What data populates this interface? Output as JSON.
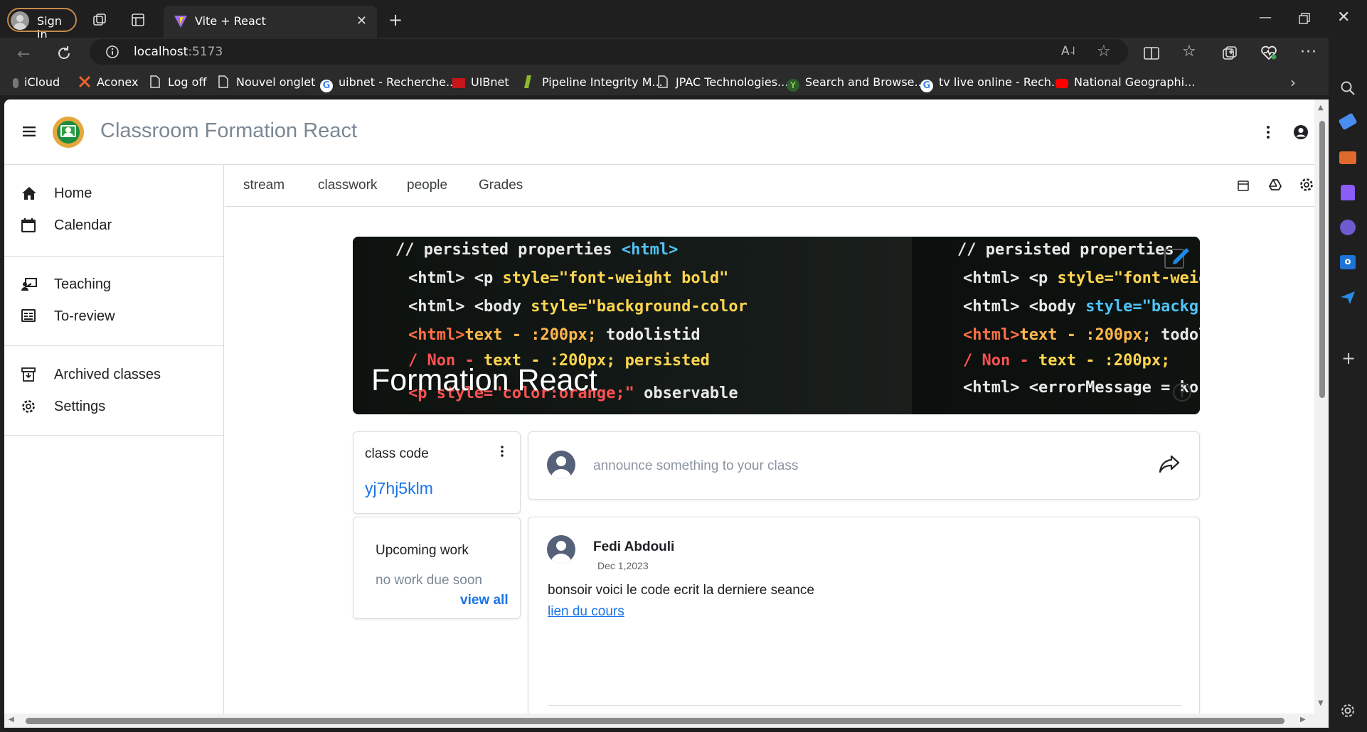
{
  "browser": {
    "signin_label": "Sign in",
    "tab_title": "Vite + React",
    "url_host": "localhost",
    "url_port": ":5173",
    "bookmarks": [
      {
        "label": "iCloud",
        "icon": "apple-icon"
      },
      {
        "label": "Aconex",
        "icon": "aconex-icon"
      },
      {
        "label": "Log off",
        "icon": "page-icon"
      },
      {
        "label": "Nouvel onglet",
        "icon": "page-icon"
      },
      {
        "label": "uibnet - Recherche...",
        "icon": "google-icon"
      },
      {
        "label": "UIBnet",
        "icon": "uibnet-icon"
      },
      {
        "label": "Pipeline Integrity M...",
        "icon": "pipeline-icon"
      },
      {
        "label": "JPAC Technologies...",
        "icon": "page-icon"
      },
      {
        "label": "Search and Browse...",
        "icon": "search-browse-icon"
      },
      {
        "label": "tv live online - Rech...",
        "icon": "google-icon"
      },
      {
        "label": "National Geographi...",
        "icon": "youtube-icon"
      }
    ]
  },
  "app": {
    "title": "Classroom Formation React"
  },
  "sidebar": {
    "items": [
      {
        "label": "Home",
        "icon": "home-icon"
      },
      {
        "label": "Calendar",
        "icon": "calendar-icon"
      },
      {
        "label": "Teaching",
        "icon": "teaching-icon"
      },
      {
        "label": "To-review",
        "icon": "to-review-icon"
      },
      {
        "label": "Archived classes",
        "icon": "archive-icon"
      },
      {
        "label": "Settings",
        "icon": "settings-icon"
      }
    ]
  },
  "tabs": [
    {
      "label": "stream"
    },
    {
      "label": "classwork"
    },
    {
      "label": "people"
    },
    {
      "label": "Grades"
    }
  ],
  "banner": {
    "course_name": "Formation React"
  },
  "class_code": {
    "label": "class code",
    "code": "yj7hj5klm"
  },
  "upcoming": {
    "title": "Upcoming work",
    "empty_text": "no work due soon",
    "view_all": "view all"
  },
  "announce": {
    "placeholder": "announce something to your class"
  },
  "post": {
    "author": "Fedi Abdouli",
    "date": "Dec 1,2023",
    "text": "bonsoir voici le code ecrit la derniere seance",
    "link": "lien du cours"
  },
  "colors": {
    "accent": "#1a73e8",
    "title_gray": "#7b8894"
  }
}
